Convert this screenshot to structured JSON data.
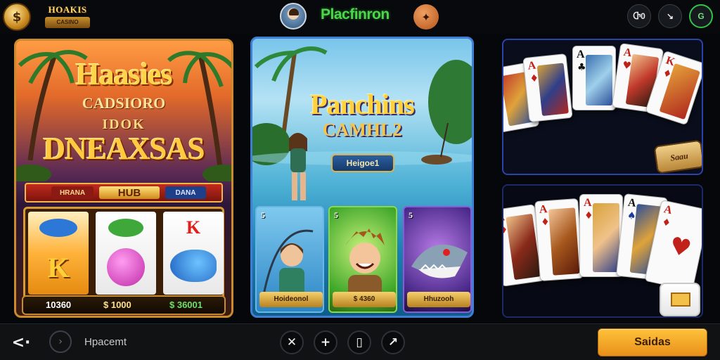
{
  "header": {
    "brand_top": "HOAKIS",
    "brand_ribbon": "CASINO",
    "app_title": "Placfinron",
    "right_buttons": [
      {
        "label": "Ⴇ0",
        "icon": "chip-icon"
      },
      {
        "label": "↘",
        "icon": "arrow-icon"
      },
      {
        "label": "G",
        "icon": "g-icon"
      }
    ]
  },
  "tiles": {
    "slots": {
      "title_line1": "Haasies",
      "title_line2": "CADSIORO",
      "title_line3": "IDOK",
      "title_line4": "DNEAXSAS",
      "banner_left": "HRANA",
      "banner_center": "HUB",
      "banner_right": "DANA",
      "amounts": [
        "10360",
        "$ 1000",
        "$ 36001"
      ]
    },
    "fishing": {
      "title_line1": "Panchins",
      "title_line2": "CAMHL2",
      "button_label": "Heigoe1",
      "minis": [
        {
          "num": "5",
          "label": "Hoideonol"
        },
        {
          "num": "5",
          "label": "$ 4360"
        },
        {
          "num": "5",
          "label": "Hhuzooh"
        }
      ]
    },
    "cards_top": {
      "ranks": [
        "A",
        "A",
        "A",
        "A",
        "K"
      ],
      "badge": "Saau"
    },
    "cards_bottom": {
      "ranks": [
        "A",
        "A",
        "A",
        "A",
        "A"
      ]
    }
  },
  "footer": {
    "home_label": "Hpacemt",
    "tools": [
      "✕",
      "+",
      "▯",
      "↗"
    ],
    "cta_label": "Saidas"
  },
  "colors": {
    "accent_green": "#4cd64a",
    "cta_orange": "#f2a72b",
    "slot_border": "#c98b2d",
    "fish_border": "#3f7ed4",
    "cards_border": "#2b43a8"
  }
}
